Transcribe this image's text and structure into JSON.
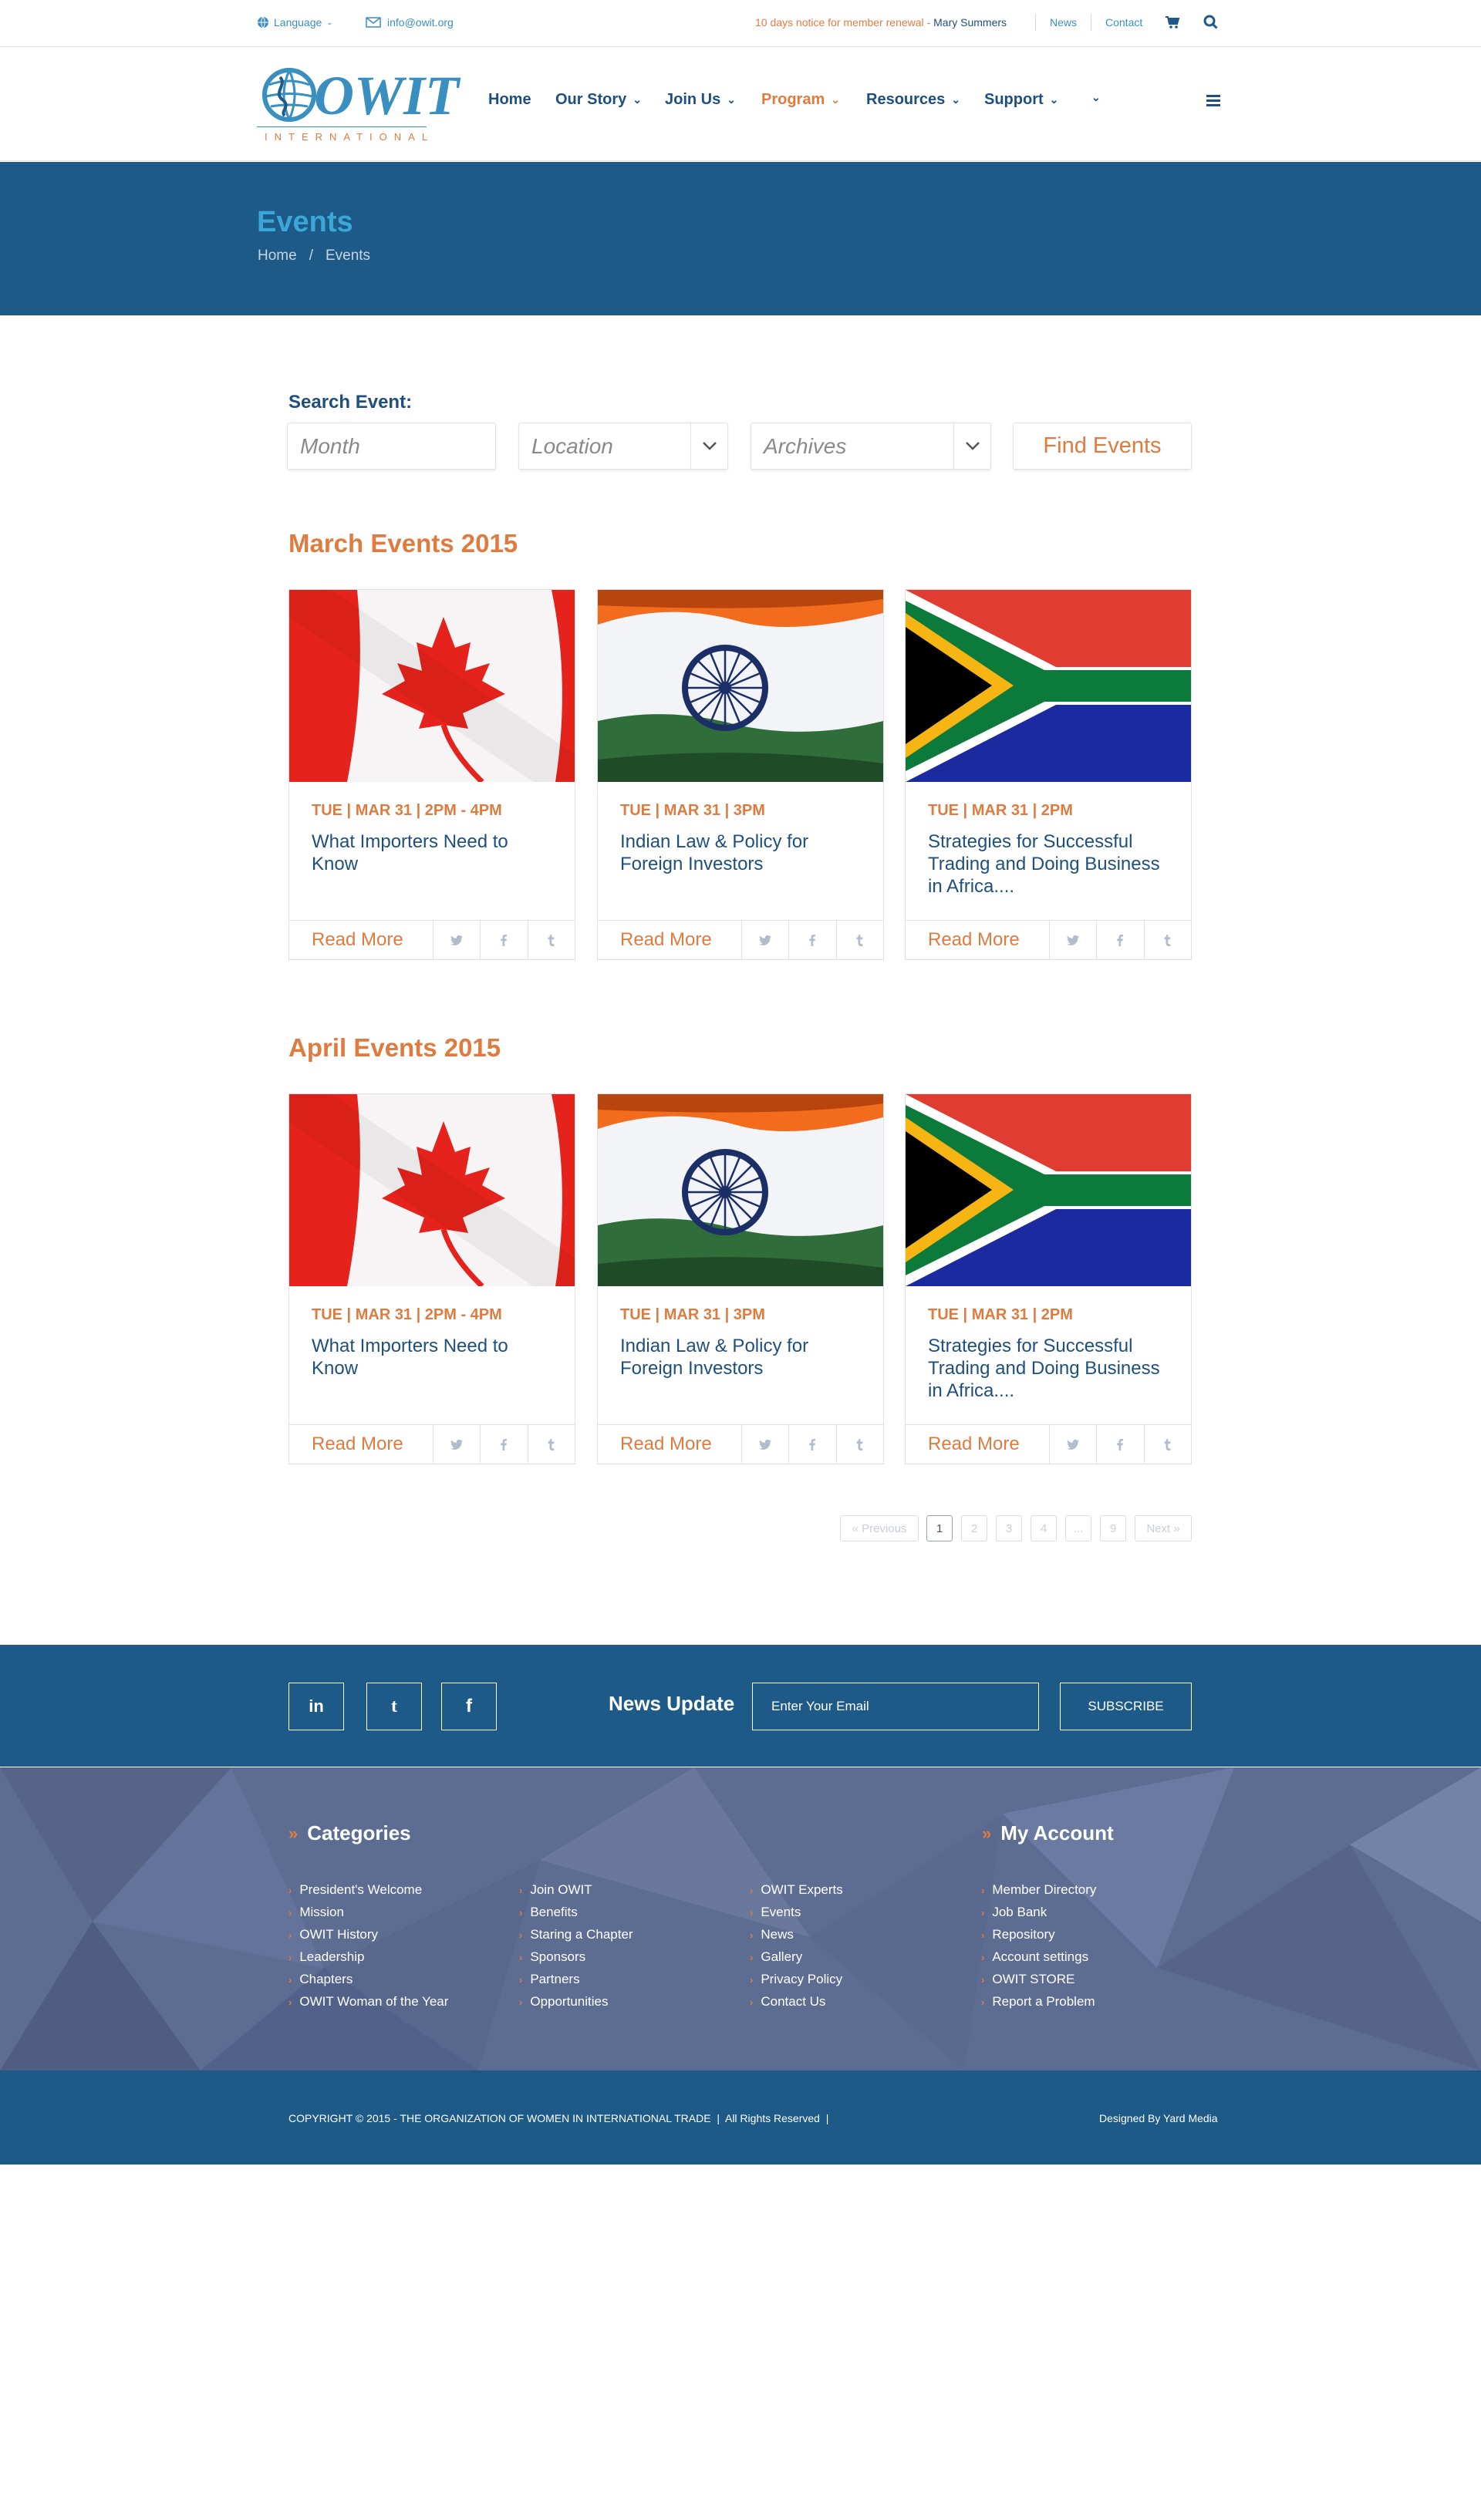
{
  "topbar": {
    "language": "Language",
    "email": "info@owit.org",
    "notice": "10 days notice for member renewal",
    "user": "Mary Summers",
    "news": "News",
    "contact": "Contact"
  },
  "logo": {
    "text": "OWIT",
    "subtitle": "INTERNATIONAL"
  },
  "nav": {
    "items": [
      {
        "label": "Home"
      },
      {
        "label": "Our Story"
      },
      {
        "label": "Join Us"
      },
      {
        "label": "Program"
      },
      {
        "label": "Resources"
      },
      {
        "label": "Support"
      }
    ]
  },
  "banner": {
    "title": "Events",
    "breadcrumb_home": "Home",
    "breadcrumb_sep": "/",
    "breadcrumb_current": "Events"
  },
  "search": {
    "label": "Search Event:",
    "month_placeholder": "Month",
    "location_placeholder": "Location",
    "archives_placeholder": "Archives",
    "button": "Find Events"
  },
  "sections": [
    {
      "title": "March Events 2015",
      "events": [
        {
          "flag": "canada",
          "date": "TUE | MAR 31 | 2PM - 4PM",
          "title": "What Importers Need to Know",
          "read_more": "Read More"
        },
        {
          "flag": "india",
          "date": "TUE | MAR 31 | 3PM",
          "title": "Indian Law & Policy for Foreign Investors",
          "read_more": "Read More"
        },
        {
          "flag": "south-africa",
          "date": "TUE | MAR 31 | 2PM",
          "title": "Strategies for Successful Trading and Doing Business in Africa....",
          "read_more": "Read More"
        }
      ]
    },
    {
      "title": "April Events 2015",
      "events": [
        {
          "flag": "canada",
          "date": "TUE | MAR 31 | 2PM - 4PM",
          "title": "What Importers Need to Know",
          "read_more": "Read More"
        },
        {
          "flag": "india",
          "date": "TUE | MAR 31 | 3PM",
          "title": "Indian Law & Policy for Foreign Investors",
          "read_more": "Read More"
        },
        {
          "flag": "south-africa",
          "date": "TUE | MAR 31 | 2PM",
          "title": "Strategies for Successful Trading and Doing Business in Africa....",
          "read_more": "Read More"
        }
      ]
    }
  ],
  "pagination": {
    "previous": "« Previous",
    "pages": [
      "1",
      "2",
      "3",
      "4",
      "...",
      "9"
    ],
    "next": "Next »",
    "current": "1"
  },
  "footer": {
    "news_update": "News Update",
    "email_placeholder": "Enter Your Email",
    "subscribe": "SUBSCRIBE",
    "categories_title": "Categories",
    "account_title": "My Account",
    "col1": [
      "President's Welcome",
      "Mission",
      "OWIT History",
      "Leadership",
      "Chapters",
      "OWIT Woman of the Year"
    ],
    "col2": [
      "Join OWIT",
      "Benefits",
      "Staring a Chapter",
      "Sponsors",
      "Partners",
      "Opportunities"
    ],
    "col3": [
      "OWIT Experts",
      "Events",
      "News",
      "Gallery",
      "Privacy Policy",
      "Contact Us"
    ],
    "col4": [
      "Member Directory",
      "Job Bank",
      "Repository",
      "Account settings",
      "OWIT STORE",
      "Report a Problem"
    ],
    "copyright": "COPYRIGHT © 2015 - THE ORGANIZATION OF WOMEN IN INTERNATIONAL TRADE  |  All Rights Reserved  |",
    "designed_by": "Designed By Yard Media"
  },
  "colors": {
    "primary": "#1d5a87",
    "accent": "#e07b40",
    "light_blue": "#3a8fc1",
    "footer_mid": "#5d6d92"
  }
}
